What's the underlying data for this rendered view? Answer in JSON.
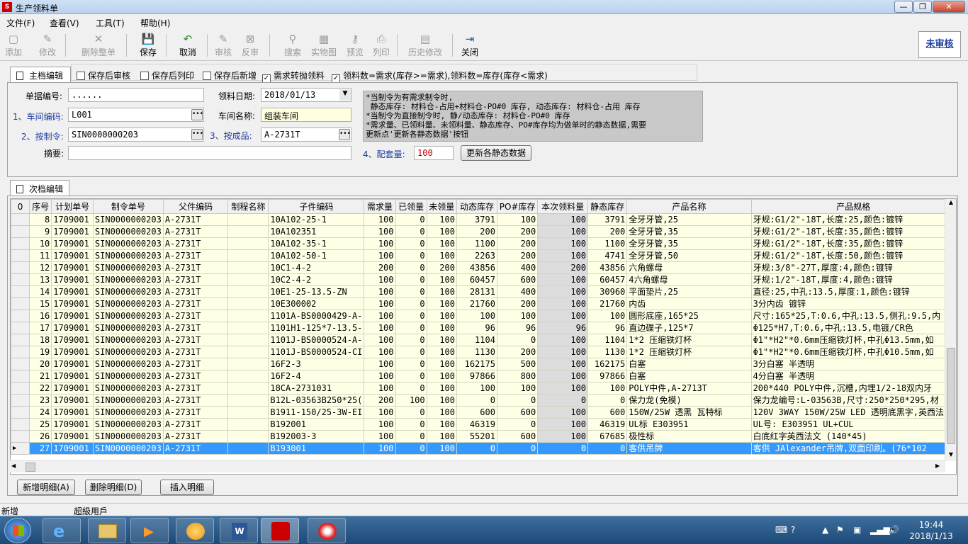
{
  "window": {
    "title": "生产领料单",
    "app_icon_text": "S"
  },
  "menu": [
    "文件(F)",
    "查看(V)",
    "工具(T)",
    "帮助(H)"
  ],
  "toolbar": {
    "add": "添加",
    "edit": "修改",
    "delete_all": "删除整单",
    "save": "保存",
    "cancel": "取消",
    "audit": "审核",
    "unaudit": "反审",
    "search": "搜索",
    "photo": "实物图",
    "preview": "预览",
    "print": "列印",
    "history": "历史修改",
    "close": "关闭",
    "status_badge": "未审核"
  },
  "main_tab": {
    "label": "主档编辑"
  },
  "options": {
    "save_audit": "保存后审核",
    "save_print": "保存后列印",
    "save_new": "保存后新增",
    "demand_convert": "需求转抛领料",
    "qty_rule": "领料数=需求(库存>=需求),领料数=库存(库存<需求)"
  },
  "form": {
    "doc_no_label": "单据编号:",
    "doc_no": "......",
    "date_label": "领料日期:",
    "date": "2018/01/13",
    "ws_code_label": "1、车间编码:",
    "ws_code": "L001",
    "ws_name_label": "车间名称:",
    "ws_name": "组装车间",
    "order_label": "2、按制令:",
    "order": "SIN0000000203",
    "product_label": "3、按成品:",
    "product": "A-2731T",
    "memo_label": "摘要:",
    "memo": "",
    "sets_label": "4、配套量:",
    "sets": "100",
    "refresh_button": "更新各静态数据"
  },
  "note": "*当制令为有需求制令时,\n 静态库存: 材料仓-占用+材料仓-PO#0 库存, 动态库存: 材料仓-占用 库存\n*当制令为直接制令时, 静/动态库存: 材料仓-PO#0 库存\n*需求量、已领料量、未领料量、静态库存、PO#库存均为做单时的静态数据,需要\n更新点'更新各静态数据'按钮",
  "detail_tab": {
    "label": "次档编辑"
  },
  "grid": {
    "corner": "0",
    "columns": [
      "序号",
      "计划单号",
      "制令单号",
      "父件编码",
      "制程名称",
      "子件编码",
      "需求量",
      "已领量",
      "未领量",
      "动态库存",
      "PO#库存",
      "本次领料量",
      "静态库存",
      "产品名称",
      "产品规格"
    ],
    "rows": [
      [
        "8",
        "1709001",
        "SIN0000000203",
        "A-2731T",
        "",
        "10A102-25-1",
        "100",
        "0",
        "100",
        "3791",
        "100",
        "100",
        "3791",
        "全牙牙管,25",
        "牙规:G1/2\"-18T,长度:25,颜色:镀锌"
      ],
      [
        "9",
        "1709001",
        "SIN0000000203",
        "A-2731T",
        "",
        "10A102351",
        "100",
        "0",
        "100",
        "200",
        "200",
        "100",
        "200",
        "全牙牙管,35",
        "牙规:G1/2\"-18T,长度:35,颜色:镀锌"
      ],
      [
        "10",
        "1709001",
        "SIN0000000203",
        "A-2731T",
        "",
        "10A102-35-1",
        "100",
        "0",
        "100",
        "1100",
        "200",
        "100",
        "1100",
        "全牙牙管,35",
        "牙规:G1/2\"-18T,长度:35,颜色:镀锌"
      ],
      [
        "11",
        "1709001",
        "SIN0000000203",
        "A-2731T",
        "",
        "10A102-50-1",
        "100",
        "0",
        "100",
        "2263",
        "200",
        "100",
        "4741",
        "全牙牙管,50",
        "牙规:G1/2\"-18T,长度:50,颜色:镀锌"
      ],
      [
        "12",
        "1709001",
        "SIN0000000203",
        "A-2731T",
        "",
        "10C1-4-2",
        "200",
        "0",
        "200",
        "43856",
        "400",
        "200",
        "43856",
        "六角螺母",
        "牙规:3/8\"-27T,厚度:4,颜色:镀锌"
      ],
      [
        "13",
        "1709001",
        "SIN0000000203",
        "A-2731T",
        "",
        "10C2-4-2",
        "100",
        "0",
        "100",
        "60457",
        "600",
        "100",
        "60457",
        "4六角螺母",
        "牙规:1/2\"-18T,厚度:4,颜色:镀锌"
      ],
      [
        "14",
        "1709001",
        "SIN0000000203",
        "A-2731T",
        "",
        "10E1-25-13.5-ZN",
        "100",
        "0",
        "100",
        "28131",
        "400",
        "100",
        "30960",
        "平面垫片,25",
        "直径:25,中孔:13.5,厚度:1,颜色:镀锌"
      ],
      [
        "15",
        "1709001",
        "SIN0000000203",
        "A-2731T",
        "",
        "10E300002",
        "100",
        "0",
        "100",
        "21760",
        "200",
        "100",
        "21760",
        "内齿",
        "3分内齿  镀锌"
      ],
      [
        "16",
        "1709001",
        "SIN0000000203",
        "A-2731T",
        "",
        "1101A-BS0000429-A-",
        "100",
        "0",
        "100",
        "100",
        "100",
        "100",
        "100",
        "圆形底座,165*25",
        "尺寸:165*25,T:0.6,中孔:13.5,侧孔:9.5,内"
      ],
      [
        "17",
        "1709001",
        "SIN0000000203",
        "A-2731T",
        "",
        "1101H1-125*7-13.5-",
        "100",
        "0",
        "100",
        "96",
        "96",
        "96",
        "96",
        "直边碟子,125*7",
        "Φ125*H7,T:0.6,中孔:13.5,电镀/CR色"
      ],
      [
        "18",
        "1709001",
        "SIN0000000203",
        "A-2731T",
        "",
        "1101J-BS0000524-A-",
        "100",
        "0",
        "100",
        "1104",
        "0",
        "100",
        "1104",
        "1*2 压缩铁灯杯",
        "Φ1\"*H2\"*0.6mm压缩铁灯杯,中孔Φ13.5mm,如"
      ],
      [
        "19",
        "1709001",
        "SIN0000000203",
        "A-2731T",
        "",
        "1101J-BS0000524-CI",
        "100",
        "0",
        "100",
        "1130",
        "200",
        "100",
        "1130",
        "1*2 压缩铁灯杯",
        "Φ1\"*H2\"*0.6mm压缩铁灯杯,中孔Φ10.5mm,如"
      ],
      [
        "20",
        "1709001",
        "SIN0000000203",
        "A-2731T",
        "",
        "16F2-3",
        "100",
        "0",
        "100",
        "162175",
        "500",
        "100",
        "162175",
        "白塞",
        "3分白塞  半透明"
      ],
      [
        "21",
        "1709001",
        "SIN0000000203",
        "A-2731T",
        "",
        "16F2-4",
        "100",
        "0",
        "100",
        "97866",
        "800",
        "100",
        "97866",
        "白塞",
        "4分白塞  半透明"
      ],
      [
        "22",
        "1709001",
        "SIN0000000203",
        "A-2731T",
        "",
        "18CA-2731031",
        "100",
        "0",
        "100",
        "100",
        "100",
        "100",
        "100",
        "POLY中件,A-2713T",
        "200*440 POLY中件,沉槽,内埋1/2-18双内牙"
      ],
      [
        "23",
        "1709001",
        "SIN0000000203",
        "A-2731T",
        "",
        "B12L-03563B250*25(",
        "200",
        "100",
        "100",
        "0",
        "0",
        "0",
        "0",
        "保力龙(免模)",
        "保力龙编号:L-03563B,尺寸:250*250*295,材"
      ],
      [
        "24",
        "1709001",
        "SIN0000000203",
        "A-2731T",
        "",
        "B1911-150/25-3W-EI",
        "100",
        "0",
        "100",
        "600",
        "600",
        "100",
        "600",
        "150W/25W 透黑 瓦特标",
        "120V 3WAY 150W/25W LED 透明底黑字,英西法"
      ],
      [
        "25",
        "1709001",
        "SIN0000000203",
        "A-2731T",
        "",
        "B192001",
        "100",
        "0",
        "100",
        "46319",
        "0",
        "100",
        "46319",
        "UL标 E303951",
        "UL号: E303951  UL+CUL"
      ],
      [
        "26",
        "1709001",
        "SIN0000000203",
        "A-2731T",
        "",
        "B192003-3",
        "100",
        "0",
        "100",
        "55201",
        "600",
        "100",
        "67685",
        "极性标",
        "白底红字英西法文  (140*45)"
      ],
      [
        "27",
        "1709001",
        "SIN0000000203",
        "A-2731T",
        "",
        "B193001",
        "100",
        "0",
        "100",
        "0",
        "0",
        "0",
        "0",
        "客供吊牌",
        "客供 JAlexander吊牌,双面印刷。(76*102"
      ]
    ],
    "selected_row": 19
  },
  "buttons": {
    "add_detail": "新增明细(A)",
    "delete_detail": "删除明细(D)",
    "insert_detail": "插入明细"
  },
  "status": {
    "mode": "新增",
    "user": "超級用戶"
  },
  "taskbar": {
    "time": "19:44",
    "date": "2018/1/13"
  }
}
